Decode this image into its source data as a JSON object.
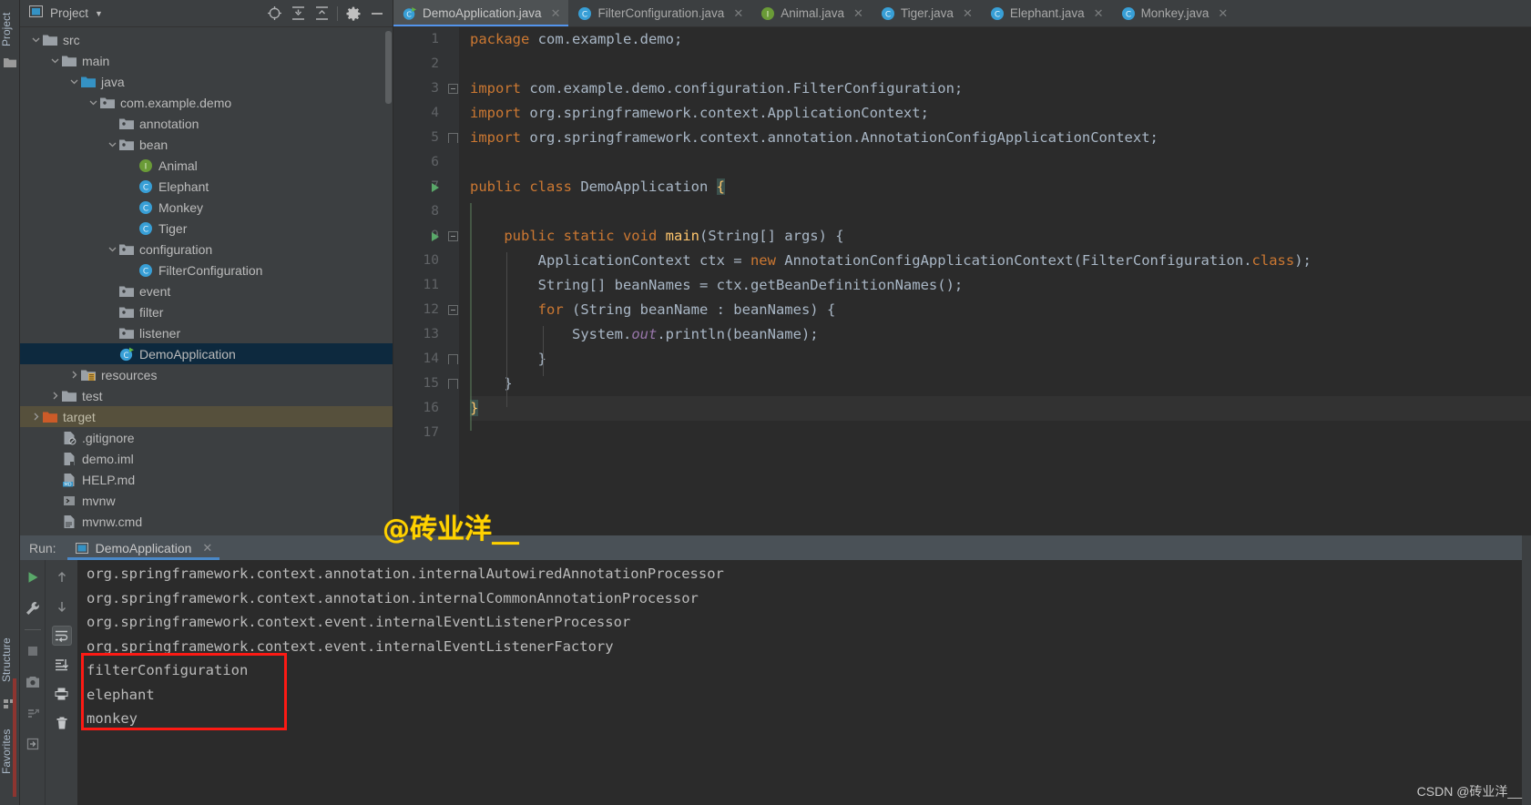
{
  "left_strip": {
    "project_label": "Project",
    "structure_label": "Structure",
    "favorites_label": "Favorites"
  },
  "project_panel": {
    "title": "Project",
    "toolbar": [
      {
        "name": "locate-icon",
        "tooltip": "Select Opened File"
      },
      {
        "name": "expand-all-icon",
        "tooltip": "Expand All"
      },
      {
        "name": "collapse-all-icon",
        "tooltip": "Collapse All"
      },
      {
        "name": "gear-icon",
        "tooltip": "Settings"
      },
      {
        "name": "minimize-icon",
        "tooltip": "Hide"
      }
    ],
    "tree": [
      {
        "label": "src",
        "icon": "folder-icon",
        "indent": 1,
        "arrow": "down",
        "state": "normal"
      },
      {
        "label": "main",
        "icon": "folder-icon",
        "indent": 2,
        "arrow": "down",
        "state": "normal"
      },
      {
        "label": "java",
        "icon": "source-folder-icon",
        "indent": 3,
        "arrow": "down",
        "state": "normal"
      },
      {
        "label": "com.example.demo",
        "icon": "package-icon",
        "indent": 4,
        "arrow": "down",
        "state": "normal"
      },
      {
        "label": "annotation",
        "icon": "package-icon",
        "indent": 5,
        "arrow": "none",
        "state": "normal"
      },
      {
        "label": "bean",
        "icon": "package-icon",
        "indent": 5,
        "arrow": "down",
        "state": "normal"
      },
      {
        "label": "Animal",
        "icon": "interface-icon",
        "indent": 6,
        "arrow": "none",
        "state": "normal"
      },
      {
        "label": "Elephant",
        "icon": "class-icon",
        "indent": 6,
        "arrow": "none",
        "state": "normal"
      },
      {
        "label": "Monkey",
        "icon": "class-icon",
        "indent": 6,
        "arrow": "none",
        "state": "normal"
      },
      {
        "label": "Tiger",
        "icon": "class-icon",
        "indent": 6,
        "arrow": "none",
        "state": "normal"
      },
      {
        "label": "configuration",
        "icon": "package-icon",
        "indent": 5,
        "arrow": "down",
        "state": "normal"
      },
      {
        "label": "FilterConfiguration",
        "icon": "class-icon",
        "indent": 6,
        "arrow": "none",
        "state": "normal"
      },
      {
        "label": "event",
        "icon": "package-icon",
        "indent": 5,
        "arrow": "none",
        "state": "normal"
      },
      {
        "label": "filter",
        "icon": "package-icon",
        "indent": 5,
        "arrow": "none",
        "state": "normal"
      },
      {
        "label": "listener",
        "icon": "package-icon",
        "indent": 5,
        "arrow": "none",
        "state": "normal"
      },
      {
        "label": "DemoApplication",
        "icon": "runnable-class-icon",
        "indent": 5,
        "arrow": "none",
        "state": "selected"
      },
      {
        "label": "resources",
        "icon": "resources-folder-icon",
        "indent": 3,
        "arrow": "right",
        "state": "normal"
      },
      {
        "label": "test",
        "icon": "folder-icon",
        "indent": 2,
        "arrow": "right",
        "state": "normal"
      },
      {
        "label": "target",
        "icon": "excluded-folder-icon",
        "indent": 1,
        "arrow": "right",
        "state": "excluded"
      },
      {
        "label": ".gitignore",
        "icon": "gitignore-file-icon",
        "indent": 2,
        "arrow": "none",
        "state": "normal"
      },
      {
        "label": "demo.iml",
        "icon": "iml-file-icon",
        "indent": 2,
        "arrow": "none",
        "state": "normal"
      },
      {
        "label": "HELP.md",
        "icon": "markdown-file-icon",
        "indent": 2,
        "arrow": "none",
        "state": "normal"
      },
      {
        "label": "mvnw",
        "icon": "shell-file-icon",
        "indent": 2,
        "arrow": "none",
        "state": "normal"
      },
      {
        "label": "mvnw.cmd",
        "icon": "cmd-file-icon",
        "indent": 2,
        "arrow": "none",
        "state": "normal"
      }
    ]
  },
  "editor": {
    "tabs": [
      {
        "label": "DemoApplication.java",
        "icon": "runnable-class-icon",
        "active": true,
        "closable": true
      },
      {
        "label": "FilterConfiguration.java",
        "icon": "class-icon",
        "active": false,
        "closable": true
      },
      {
        "label": "Animal.java",
        "icon": "interface-icon",
        "active": false,
        "closable": true
      },
      {
        "label": "Tiger.java",
        "icon": "class-icon",
        "active": false,
        "closable": true
      },
      {
        "label": "Elephant.java",
        "icon": "class-icon",
        "active": false,
        "closable": true
      },
      {
        "label": "Monkey.java",
        "icon": "class-icon",
        "active": false,
        "closable": true
      }
    ],
    "line_numbers": [
      "1",
      "2",
      "3",
      "4",
      "5",
      "6",
      "7",
      "8",
      "9",
      "10",
      "11",
      "12",
      "13",
      "14",
      "15",
      "16",
      "17"
    ],
    "code_lines": [
      [
        {
          "t": "package",
          "c": "kw"
        },
        {
          "t": " com.example.demo;",
          "c": "txt"
        }
      ],
      [],
      [
        {
          "t": "import",
          "c": "kw"
        },
        {
          "t": " com.example.demo.configuration.FilterConfiguration;",
          "c": "txt"
        }
      ],
      [
        {
          "t": "import",
          "c": "kw"
        },
        {
          "t": " org.springframework.context.ApplicationContext;",
          "c": "txt"
        }
      ],
      [
        {
          "t": "import",
          "c": "kw"
        },
        {
          "t": " org.springframework.context.annotation.AnnotationConfigApplicationContext;",
          "c": "txt"
        }
      ],
      [],
      [
        {
          "t": "public class",
          "c": "kw"
        },
        {
          "t": " DemoApplication ",
          "c": "txt"
        },
        {
          "t": "{",
          "c": "brace-match"
        }
      ],
      [],
      [
        {
          "t": "    ",
          "c": "txt"
        },
        {
          "t": "public static void",
          "c": "kw"
        },
        {
          "t": " ",
          "c": "txt"
        },
        {
          "t": "main",
          "c": "fn"
        },
        {
          "t": "(String[] args) {",
          "c": "txt"
        }
      ],
      [
        {
          "t": "        ApplicationContext ctx = ",
          "c": "txt"
        },
        {
          "t": "new",
          "c": "kw"
        },
        {
          "t": " AnnotationConfigApplicationContext(FilterConfiguration.",
          "c": "txt"
        },
        {
          "t": "class",
          "c": "kw"
        },
        {
          "t": ");",
          "c": "txt"
        }
      ],
      [
        {
          "t": "        String[] beanNames = ctx.getBeanDefinitionNames();",
          "c": "txt"
        }
      ],
      [
        {
          "t": "        ",
          "c": "txt"
        },
        {
          "t": "for",
          "c": "kw"
        },
        {
          "t": " (String beanName : beanNames) {",
          "c": "txt"
        }
      ],
      [
        {
          "t": "            System.",
          "c": "txt"
        },
        {
          "t": "out",
          "c": "stat"
        },
        {
          "t": ".println(beanName);",
          "c": "txt"
        }
      ],
      [
        {
          "t": "        }",
          "c": "txt"
        }
      ],
      [
        {
          "t": "    }",
          "c": "txt"
        }
      ],
      [
        {
          "t": "}",
          "c": "brace-match"
        }
      ],
      []
    ]
  },
  "run_panel": {
    "label": "Run:",
    "tab_name": "DemoApplication",
    "tab_icon": "run-config-icon",
    "toolbar_left": [
      {
        "name": "rerun-icon",
        "tooltip": "Rerun"
      },
      {
        "name": "settings-wrench-icon",
        "tooltip": "Edit Configuration"
      },
      {
        "name": "stop-icon",
        "tooltip": "Stop"
      },
      {
        "name": "camera-icon",
        "tooltip": "Capture Memory Snapshot"
      },
      {
        "name": "thread-dump-icon",
        "tooltip": "Dump Threads"
      },
      {
        "name": "exit-icon",
        "tooltip": "Close"
      }
    ],
    "toolbar_right": [
      {
        "name": "arrow-up-icon",
        "tooltip": "Up the Stack Trace"
      },
      {
        "name": "arrow-down-icon",
        "tooltip": "Down the Stack Trace"
      },
      {
        "name": "soft-wrap-icon",
        "tooltip": "Soft-Wrap",
        "active": true
      },
      {
        "name": "scroll-to-end-icon",
        "tooltip": "Scroll to End"
      },
      {
        "name": "print-icon",
        "tooltip": "Print"
      },
      {
        "name": "trash-icon",
        "tooltip": "Clear All"
      }
    ],
    "console_lines": [
      "org.springframework.context.annotation.internalAutowiredAnnotationProcessor",
      "org.springframework.context.annotation.internalCommonAnnotationProcessor",
      "org.springframework.context.event.internalEventListenerProcessor",
      "org.springframework.context.event.internalEventListenerFactory",
      "filterConfiguration",
      "elephant",
      "monkey"
    ],
    "highlight_box": {
      "color": "#fc1a14",
      "first_line_index": 4,
      "line_count": 3
    }
  },
  "watermarks": {
    "center": "@砖业洋__",
    "bottom_right": "CSDN @砖业洋__"
  },
  "colors": {
    "background": "#3c3f41",
    "editor_background": "#2b2b2b",
    "accent_blue": "#5394ec",
    "selection": "#0d293e",
    "excluded": "#56503c",
    "keyword_orange": "#cc7832",
    "text_grey": "#a9b7c6",
    "method_yellow": "#ffc66d",
    "static_purple": "#9876aa",
    "run_green": "#59a869",
    "highlight_red": "#fc1a14",
    "watermark_yellow": "#ffd200"
  }
}
